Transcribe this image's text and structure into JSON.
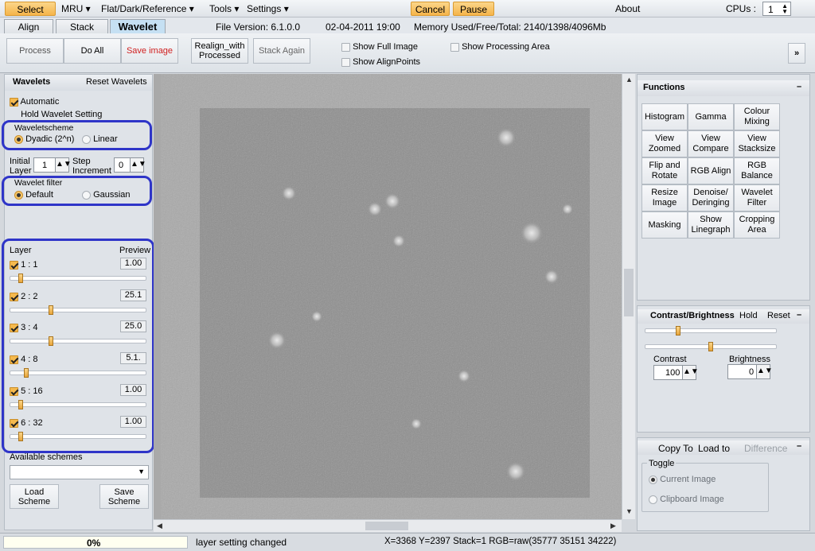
{
  "menu": {
    "select": "Select",
    "mru": "MRU",
    "flat": "Flat/Dark/Reference",
    "tools": "Tools",
    "settings": "Settings",
    "cancel": "Cancel",
    "pause": "Pause",
    "about": "About",
    "cpus_label": "CPUs :",
    "cpus_value": "1"
  },
  "tabs": {
    "align": "Align",
    "stack": "Stack",
    "wavelet": "Wavelet"
  },
  "info": {
    "file_version": "File Version: 6.1.0.0",
    "date": "02-04-2011 19:00",
    "memory": "Memory Used/Free/Total: 2140/1398/4096Mb"
  },
  "toolbar": {
    "process": "Process",
    "do_all": "Do All",
    "save_image": "Save image",
    "realign": "Realign_with Processed",
    "stack_again": "Stack Again",
    "show_full_image": "Show Full Image",
    "show_alignpoints": "Show AlignPoints",
    "show_processing_area": "Show Processing Area",
    "expand": "»"
  },
  "wavelets": {
    "title": "Wavelets",
    "reset": "Reset Wavelets",
    "automatic": "Automatic",
    "hold": "Hold Wavelet Setting",
    "scheme_label": "Waveletscheme",
    "dyadic": "Dyadic (2^n)",
    "linear": "Linear",
    "initial_layer_1": "Initial",
    "initial_layer_2": "Layer",
    "initial_value": "1",
    "step_1": "Step",
    "step_2": "Increment",
    "step_value": "0",
    "filter_label": "Wavelet filter",
    "default": "Default",
    "gaussian": "Gaussian",
    "layer_header": "Layer",
    "preview_header": "Preview",
    "layers": [
      {
        "label": "1 : 1",
        "value": "1.00",
        "pos": 0.06
      },
      {
        "label": "2 : 2",
        "value": "25.1",
        "pos": 0.29
      },
      {
        "label": "3 : 4",
        "value": "25.0",
        "pos": 0.29
      },
      {
        "label": "4 : 8",
        "value": "5.1.",
        "pos": 0.1
      },
      {
        "label": "5 : 16",
        "value": "1.00",
        "pos": 0.06
      },
      {
        "label": "6 : 32",
        "value": "1.00",
        "pos": 0.06
      }
    ],
    "available_schemes": "Available schemes",
    "load_scheme": "Load Scheme",
    "save_scheme": "Save Scheme"
  },
  "functions": {
    "title": "Functions",
    "collapse": "–",
    "buttons": [
      "Histogram",
      "Gamma",
      "Colour Mixing",
      "View Zoomed",
      "View Compare",
      "View Stacksize",
      "Flip and Rotate",
      "RGB Align",
      "RGB Balance",
      "Resize Image",
      "Denoise/ Deringing",
      "Wavelet Filter",
      "Masking",
      "Show Linegraph",
      "Cropping Area"
    ]
  },
  "contrast": {
    "title": "Contrast/Brightness",
    "hold": "Hold",
    "reset": "Reset",
    "collapse": "–",
    "contrast_label": "Contrast",
    "contrast_value": "100",
    "brightness_label": "Brightness",
    "brightness_value": "0"
  },
  "copy": {
    "copy_to": "Copy To",
    "load_to": "Load to",
    "difference": "Difference",
    "collapse": "–",
    "toggle": "Toggle",
    "current_image": "Current Image",
    "clipboard_image": "Clipboard Image"
  },
  "status": {
    "progress": "0%",
    "message": "layer setting changed",
    "coords": "X=3368 Y=2397 Stack=1 RGB=raw(35777 35151 34222)"
  }
}
